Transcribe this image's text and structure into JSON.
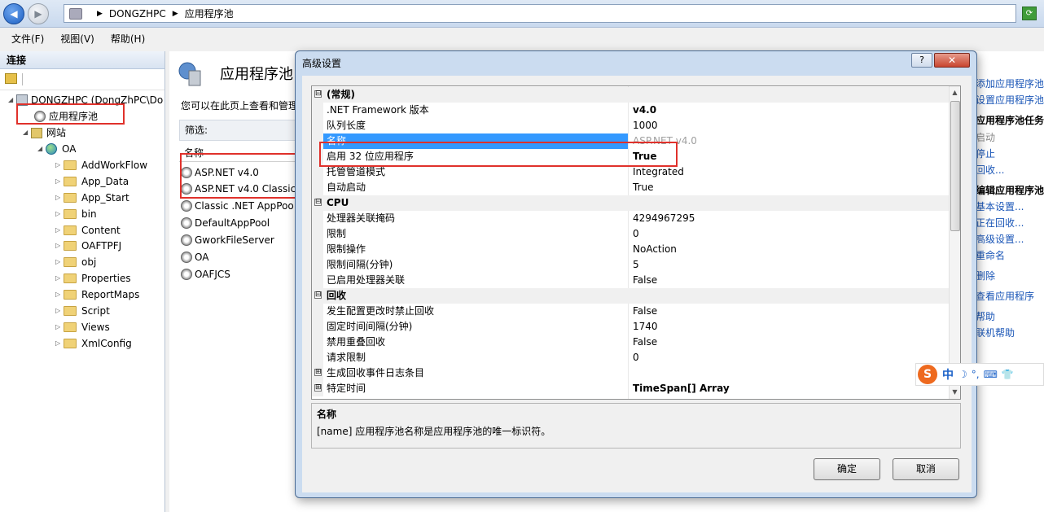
{
  "nav": {
    "breadcrumb": [
      "DONGZHPC",
      "应用程序池"
    ],
    "back_glyph": "◀",
    "forward_glyph": "▶",
    "sep_glyph": "▶",
    "refresh_glyph": "⟳"
  },
  "menu": [
    "文件(F)",
    "视图(V)",
    "帮助(H)"
  ],
  "connections": {
    "header": "连接",
    "tree": {
      "server": "DONGZHPC (DongZhPC\\Do",
      "app_pools": "应用程序池",
      "sites": "网站",
      "site": "OA",
      "folders": [
        "AddWorkFlow",
        "App_Data",
        "App_Start",
        "bin",
        "Content",
        "OAFTPFJ",
        "obj",
        "Properties",
        "ReportMaps",
        "Script",
        "Views",
        "XmlConfig"
      ]
    }
  },
  "main": {
    "title": "应用程序池",
    "description": "您可以在此页上查看和管理",
    "filter_label": "筛选:",
    "column_name": "名称",
    "pools": [
      "ASP.NET v4.0",
      "ASP.NET v4.0 Classic",
      "Classic .NET AppPoo",
      "DefaultAppPool",
      "GworkFileServer",
      "OA",
      "OAFJCS"
    ]
  },
  "actions": {
    "items": [
      {
        "text": "添加应用程序池...",
        "style": "link"
      },
      {
        "text": "设置应用程序池默",
        "style": "link"
      },
      {
        "text": "应用程序池任务",
        "style": "header"
      },
      {
        "text": "启动",
        "style": "dim"
      },
      {
        "text": "停止",
        "style": "link"
      },
      {
        "text": "回收...",
        "style": "link"
      },
      {
        "text": "编辑应用程序池",
        "style": "header"
      },
      {
        "text": "基本设置...",
        "style": "link"
      },
      {
        "text": "正在回收...",
        "style": "link"
      },
      {
        "text": "高级设置...",
        "style": "link"
      },
      {
        "text": "重命名",
        "style": "link"
      },
      {
        "text": "删除",
        "style": "link"
      },
      {
        "text": "查看应用程序",
        "style": "link"
      },
      {
        "text": "帮助",
        "style": "link"
      },
      {
        "text": "联机帮助",
        "style": "link"
      }
    ]
  },
  "dialog": {
    "title": "高级设置",
    "help_label": "?",
    "close_label": "✕",
    "rows": [
      {
        "type": "category",
        "label": "(常规)",
        "expander": "⊟"
      },
      {
        "type": "prop",
        "key": ".NET Framework 版本",
        "value": "v4.0",
        "bold": true
      },
      {
        "type": "prop",
        "key": "队列长度",
        "value": "1000"
      },
      {
        "type": "prop",
        "key": "名称",
        "value": "ASP.NET v4.0",
        "selected": true
      },
      {
        "type": "prop",
        "key": "启用 32 位应用程序",
        "value": "True",
        "bold": true
      },
      {
        "type": "prop",
        "key": "托管管道模式",
        "value": "Integrated"
      },
      {
        "type": "prop",
        "key": "自动启动",
        "value": "True"
      },
      {
        "type": "category",
        "label": "CPU",
        "expander": "⊟"
      },
      {
        "type": "prop",
        "key": "处理器关联掩码",
        "value": "4294967295"
      },
      {
        "type": "prop",
        "key": "限制",
        "value": "0"
      },
      {
        "type": "prop",
        "key": "限制操作",
        "value": "NoAction"
      },
      {
        "type": "prop",
        "key": "限制间隔(分钟)",
        "value": "5"
      },
      {
        "type": "prop",
        "key": "已启用处理器关联",
        "value": "False"
      },
      {
        "type": "category",
        "label": "回收",
        "expander": "⊟"
      },
      {
        "type": "prop",
        "key": "发生配置更改时禁止回收",
        "value": "False"
      },
      {
        "type": "prop",
        "key": "固定时间间隔(分钟)",
        "value": "1740"
      },
      {
        "type": "prop",
        "key": "禁用重叠回收",
        "value": "False"
      },
      {
        "type": "prop",
        "key": "请求限制",
        "value": "0"
      },
      {
        "type": "prop",
        "key": "生成回收事件日志条目",
        "value": "",
        "expander": "⊞"
      },
      {
        "type": "prop",
        "key": "特定时间",
        "value": "TimeSpan[] Array",
        "bold": true,
        "expander": "⊞"
      }
    ],
    "description_title": "名称",
    "description_text": "[name] 应用程序池名称是应用程序池的唯一标识符。",
    "ok_label": "确定",
    "cancel_label": "取消"
  },
  "ime": {
    "logo": "S",
    "lang": "中",
    "glyphs": [
      "☽",
      "°,",
      "⌨",
      "👕"
    ]
  },
  "colors": {
    "highlight": "#e0312b",
    "selection": "#3399ff",
    "link": "#1a56b7"
  }
}
